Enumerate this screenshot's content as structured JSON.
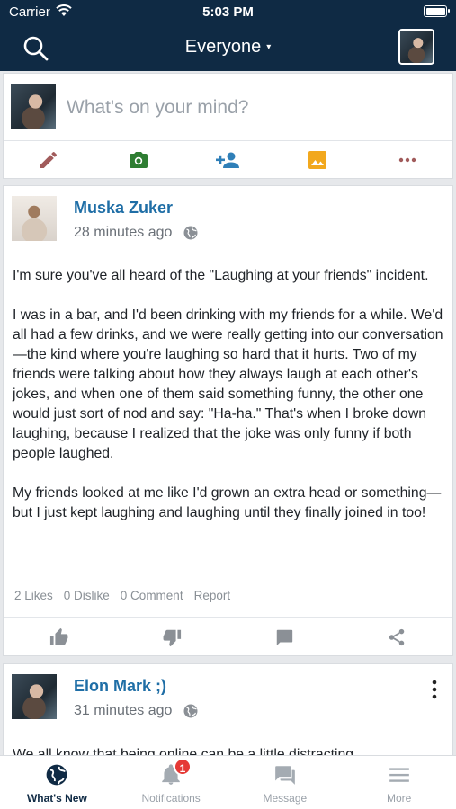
{
  "status_bar": {
    "carrier": "Carrier",
    "time": "5:03 PM"
  },
  "header": {
    "title": "Everyone",
    "caret": "▾"
  },
  "composer": {
    "placeholder": "What's on your mind?",
    "actions": [
      {
        "icon": "pencil-icon",
        "color": "#a15b5b"
      },
      {
        "icon": "camera-icon",
        "color": "#2e7d32"
      },
      {
        "icon": "add-person-icon",
        "color": "#2f7fb8"
      },
      {
        "icon": "image-icon",
        "color": "#f2a81d"
      },
      {
        "icon": "more-icon",
        "color": "#a15b5b"
      }
    ]
  },
  "posts": [
    {
      "author": "Muska Zuker",
      "time": "28 minutes ago",
      "paragraphs": [
        "I'm sure you've all heard of the \"Laughing at your friends\" incident.",
        "I was in a bar, and I'd been drinking with my friends for a while. We'd all had a few drinks, and we were really getting into our conversation—the kind where you're laughing so hard that it hurts. Two of my friends were talking about how they always laugh at each other's jokes, and when one of them said something funny, the other one would just sort of nod and say: \"Ha-ha.\" That's when I broke down laughing, because I realized that the joke was only funny if both people laughed.",
        "My friends looked at me like I'd grown an extra head or something—but I just kept laughing and laughing until they finally joined in too!"
      ],
      "stats": {
        "likes": "2 Likes",
        "dislikes": "0 Dislike",
        "comments": "0 Comment",
        "report": "Report"
      }
    },
    {
      "author": "Elon Mark ;)",
      "time": "31 minutes ago",
      "preview": "We all know that being online can be a little distracting"
    }
  ],
  "bottom_nav": [
    {
      "label": "What's New",
      "icon": "globe-icon",
      "active": true
    },
    {
      "label": "Notifications",
      "icon": "bell-icon",
      "badge": "1"
    },
    {
      "label": "Message",
      "icon": "chat-icon"
    },
    {
      "label": "More",
      "icon": "menu-icon"
    }
  ],
  "colors": {
    "nav_bg": "#0f2a44",
    "accent_link": "#1f6ea6",
    "badge": "#e53935"
  }
}
